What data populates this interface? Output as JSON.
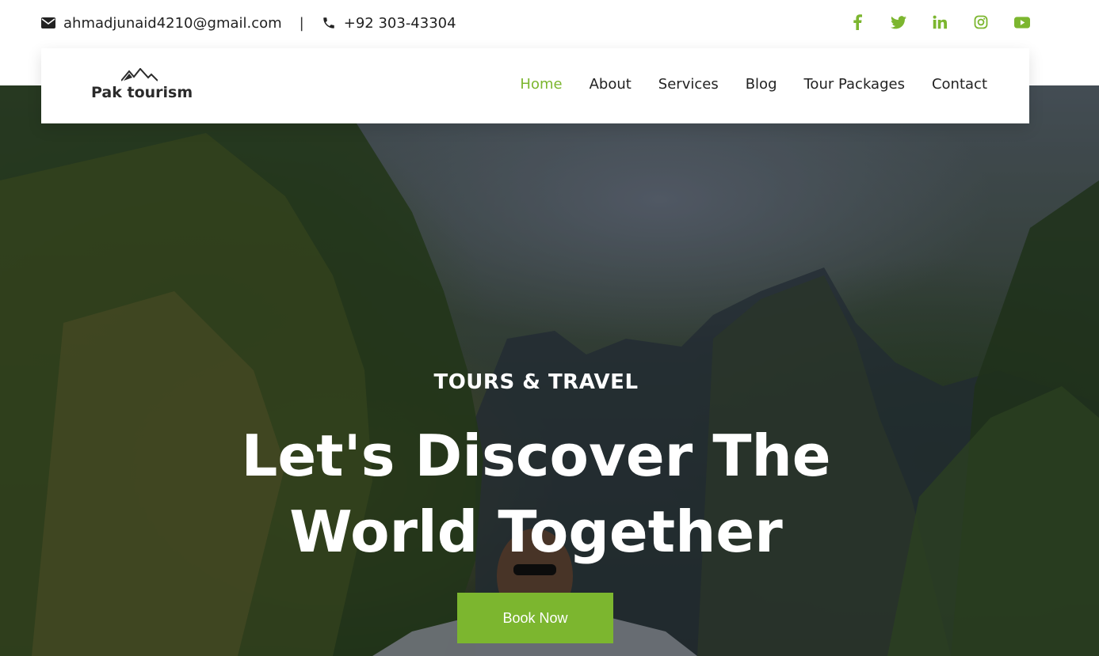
{
  "topbar": {
    "email": "ahmadjunaid4210@gmail.com",
    "separator": "|",
    "phone": "+92 303-43304",
    "email_icon": "envelope-icon",
    "phone_icon": "phone-icon",
    "social_icons": [
      "facebook-icon",
      "twitter-icon",
      "linkedin-icon",
      "instagram-icon",
      "youtube-icon"
    ]
  },
  "brand": {
    "name": "Pak tourism",
    "logo_icon": "mountains-icon"
  },
  "nav": {
    "items": [
      {
        "label": "Home",
        "active": true
      },
      {
        "label": "About"
      },
      {
        "label": "Services"
      },
      {
        "label": "Blog"
      },
      {
        "label": "Tour Packages"
      },
      {
        "label": "Contact"
      }
    ]
  },
  "hero": {
    "kicker": "TOURS & TRAVEL",
    "headline_line1": "Let's Discover The",
    "headline_line2": "World Together",
    "cta": "Book Now"
  },
  "colors": {
    "accent": "#7cb62f",
    "text": "#222222",
    "white": "#ffffff"
  }
}
